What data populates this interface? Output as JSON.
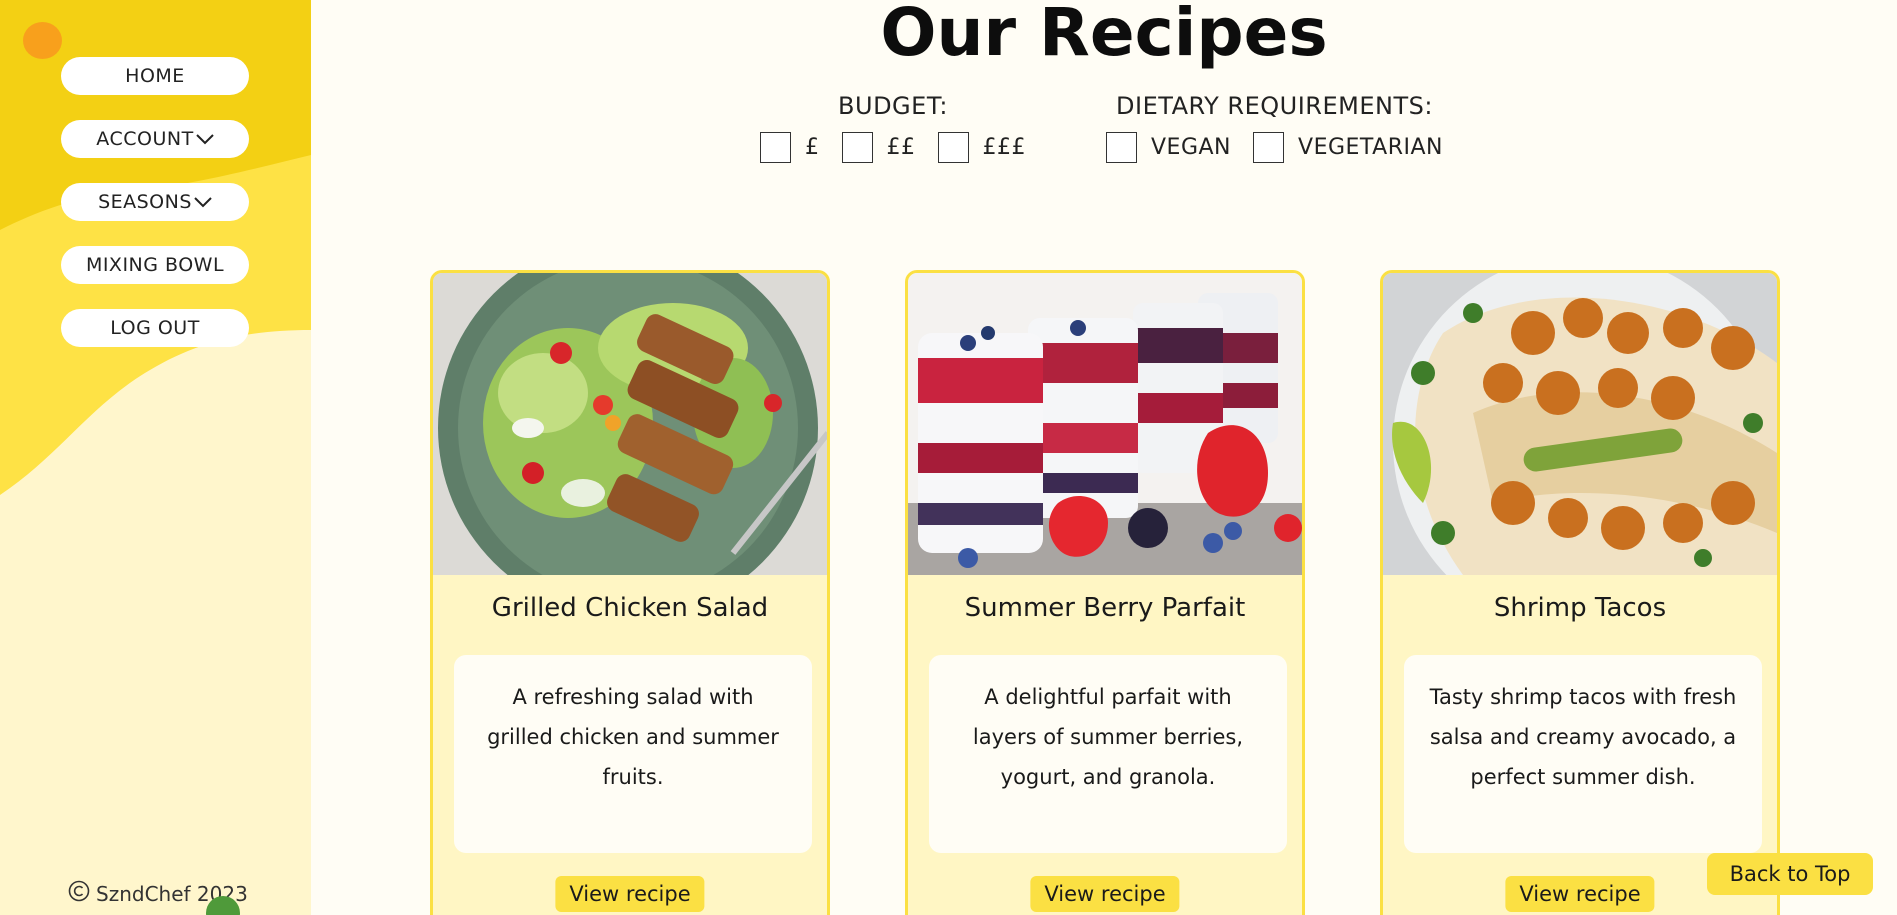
{
  "nav": {
    "home": "HOME",
    "account": "ACCOUNT",
    "seasons": "SEASONS",
    "mixing_bowl": "MIXING BOWL",
    "logout": "LOG OUT"
  },
  "footer": {
    "copyright": "SzndChef 2023"
  },
  "page": {
    "title": "Our Recipes"
  },
  "filters": {
    "budget": {
      "heading": "BUDGET:",
      "options": [
        "£",
        "££",
        "£££"
      ]
    },
    "dietary": {
      "heading": "DIETARY REQUIREMENTS:",
      "options": [
        "VEGAN",
        "VEGETARIAN"
      ]
    }
  },
  "recipes": [
    {
      "title": "Grilled Chicken Salad",
      "description": "A refreshing salad with grilled chicken and summer fruits.",
      "button": "View recipe"
    },
    {
      "title": "Summer Berry Parfait",
      "description": "A delightful parfait with layers of summer berries, yogurt, and granola.",
      "button": "View recipe"
    },
    {
      "title": "Shrimp Tacos",
      "description": "Tasty shrimp tacos with fresh salsa and creamy avocado, a perfect summer dish.",
      "button": "View recipe"
    }
  ],
  "back_to_top": "Back to Top",
  "colors": {
    "accent_yellow": "#fbe043",
    "sidebar_dark": "#f3d014",
    "sidebar_mid": "#fee245",
    "sidebar_light": "#fff6cc",
    "card_bg": "#fff6c4",
    "orange_dot": "#f8a01c",
    "green_dot": "#4f9a3a"
  },
  "icons": {
    "chevron": "chevron-down-icon",
    "copyright": "copyright-icon",
    "checkbox": "checkbox-icon"
  }
}
